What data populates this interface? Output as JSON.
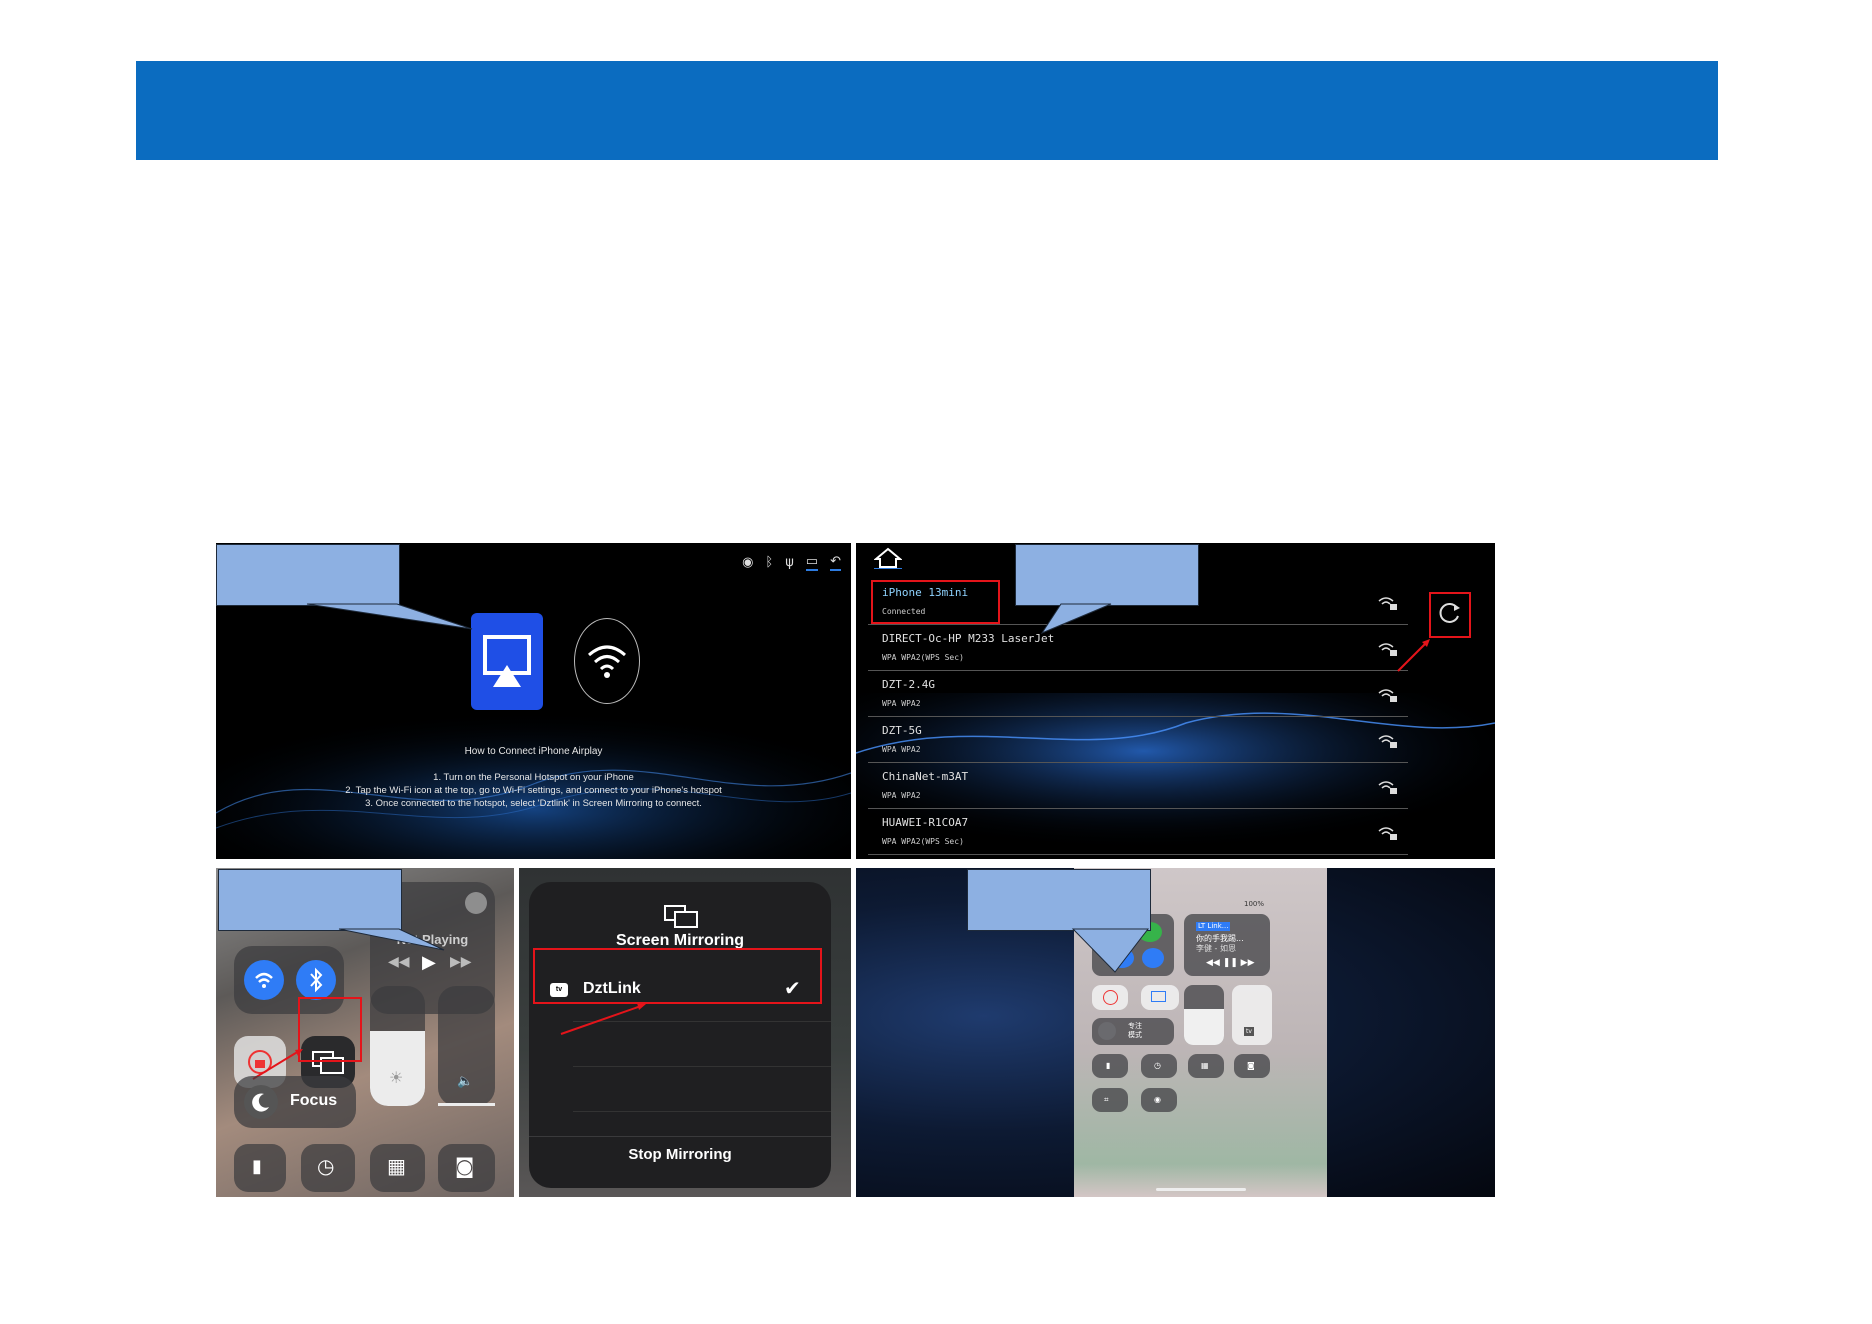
{
  "panel1": {
    "title": "How to Connect iPhone Airplay",
    "steps": [
      "1. Turn on the Personal Hotspot on your iPhone",
      "2. Tap the Wi-Fi icon at the top, go to Wi-Fi settings, and connect to your iPhone's hotspot",
      "3. Once connected to the hotspot, select 'Dztlink' in Screen Mirroring to connect."
    ],
    "icons": [
      "wifi-status-icon",
      "bluetooth-icon",
      "usb-icon",
      "screen-icon",
      "back-icon"
    ]
  },
  "panel2": {
    "networks": [
      {
        "name": "iPhone 13mini",
        "status": "Connected"
      },
      {
        "name": "DIRECT-Oc-HP M233 LaserJet",
        "status": "WPA WPA2(WPS Sec)"
      },
      {
        "name": "DZT-2.4G",
        "status": "WPA WPA2"
      },
      {
        "name": "DZT-5G",
        "status": "WPA WPA2"
      },
      {
        "name": "ChinaNet-m3AT",
        "status": "WPA WPA2"
      },
      {
        "name": "HUAWEI-R1COA7",
        "status": "WPA WPA2(WPS Sec)"
      }
    ]
  },
  "panel3": {
    "now_playing": "Not Playing",
    "focus_label": "Focus"
  },
  "panel4": {
    "title": "Screen Mirroring",
    "device_badge": "tv",
    "device_name": "DztLink",
    "stop_label": "Stop Mirroring"
  },
  "panel5": {
    "battery": "100%",
    "media_title": "LT Link...",
    "media_line1": "你的手我踢...",
    "media_line2": "李健 - 如恩",
    "focus_label_line1": "专注",
    "focus_label_line2": "模式",
    "apple_tv": "tv"
  },
  "colors": {
    "banner": "#0b6cc0",
    "callout": "#8db0e2",
    "highlight": "#e4141a",
    "airplay_tile": "#1f4fe6"
  }
}
